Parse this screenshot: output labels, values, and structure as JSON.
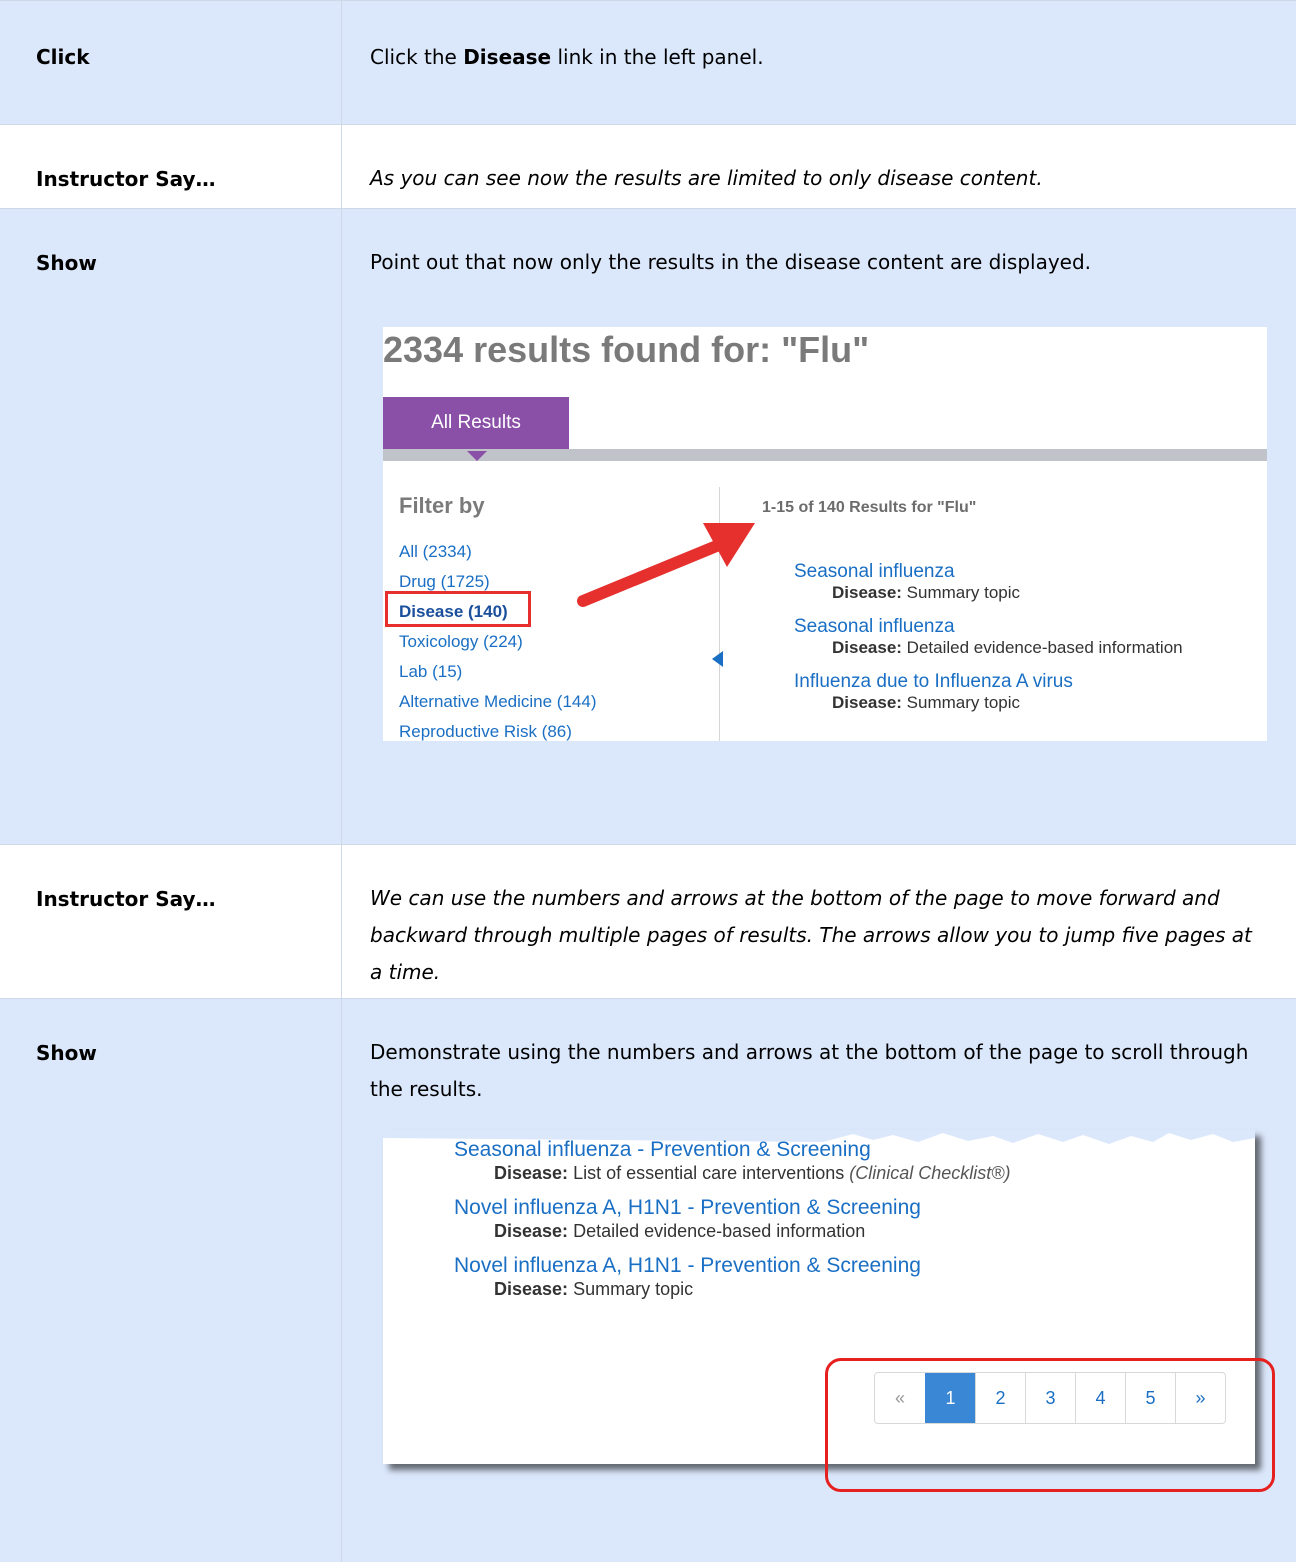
{
  "rows": [
    {
      "label": "Click",
      "text_before": "Click the ",
      "text_bold": "Disease",
      "text_after": " link in the left panel."
    },
    {
      "label": "Instructor Say…",
      "text": "As you can see now the results are limited to only disease content."
    },
    {
      "label": "Show",
      "text": "Point out that now only the results in the disease content are displayed."
    },
    {
      "label": "Instructor Say…",
      "text": "We can use the numbers and arrows at the bottom of the page to move forward and backward through multiple pages of results. The arrows allow you to jump five pages at a time."
    },
    {
      "label": "Show",
      "text": "Demonstrate using the numbers and arrows at the bottom of the page to scroll through the results."
    }
  ],
  "screenshot1": {
    "title": "2334 results found for: \"Flu\"",
    "tab_label": "All Results",
    "filter_title": "Filter by",
    "filters": [
      "All (2334)",
      "Drug (1725)",
      "Disease (140)",
      "Toxicology (224)",
      "Lab (15)",
      "Alternative Medicine (144)",
      "Reproductive Risk (86)"
    ],
    "results_count": "1-15 of 140 Results for \"Flu\"",
    "results": [
      {
        "title": "Seasonal influenza",
        "type": "Disease:",
        "desc": "Summary topic"
      },
      {
        "title": "Seasonal influenza",
        "type": "Disease:",
        "desc": "Detailed evidence-based information"
      },
      {
        "title": "Influenza due to Influenza A virus",
        "type": "Disease:",
        "desc": "Summary topic"
      }
    ]
  },
  "screenshot2": {
    "results": [
      {
        "title": "Seasonal influenza - Prevention & Screening",
        "type": "Disease:",
        "desc": "List of essential care interventions",
        "extra": "(Clinical Checklist®)"
      },
      {
        "title": "Novel influenza A, H1N1 - Prevention & Screening",
        "type": "Disease:",
        "desc": "Detailed evidence-based information",
        "extra": ""
      },
      {
        "title": "Novel influenza A, H1N1 - Prevention & Screening",
        "type": "Disease:",
        "desc": "Summary topic",
        "extra": ""
      }
    ],
    "pager": [
      "«",
      "1",
      "2",
      "3",
      "4",
      "5",
      "»"
    ],
    "current_page": "1"
  },
  "colors": {
    "row_blue": "#dbe7fb",
    "tab_purple": "#8a4fa6",
    "link_blue": "#1a6fc4",
    "highlight_red": "#e5302e",
    "pager_active": "#3a87d6"
  }
}
